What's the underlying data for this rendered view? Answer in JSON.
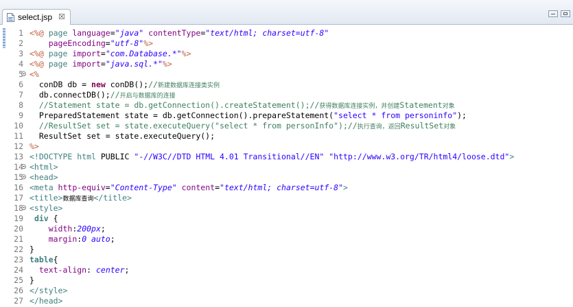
{
  "tab": {
    "label": "select.jsp",
    "icon": "jsp-file-icon",
    "close_glyph": "☒"
  },
  "colors": {
    "keyword": "#7f0055",
    "directive": "#bf5f3f",
    "tag": "#3f7f7f",
    "attribute": "#7f007f",
    "value": "#2a00ff",
    "comment": "#3f7f5f"
  },
  "lines": [
    {
      "n": "1",
      "fold": false,
      "tokens": [
        {
          "t": "dir",
          "v": "<%@ "
        },
        {
          "t": "tag",
          "v": "page "
        },
        {
          "t": "attr",
          "v": "language"
        },
        {
          "t": "plain",
          "v": "="
        },
        {
          "t": "val",
          "v": "\"java\""
        },
        {
          "t": "plain",
          "v": " "
        },
        {
          "t": "attr",
          "v": "contentType"
        },
        {
          "t": "plain",
          "v": "="
        },
        {
          "t": "val",
          "v": "\"text/html; charset=utf-8\""
        }
      ]
    },
    {
      "n": "2",
      "fold": false,
      "tokens": [
        {
          "t": "plain",
          "v": "    "
        },
        {
          "t": "attr",
          "v": "pageEncoding"
        },
        {
          "t": "plain",
          "v": "="
        },
        {
          "t": "val",
          "v": "\"utf-8\""
        },
        {
          "t": "dir",
          "v": "%>"
        }
      ]
    },
    {
      "n": "3",
      "fold": false,
      "tokens": [
        {
          "t": "dir",
          "v": "<%@ "
        },
        {
          "t": "tag",
          "v": "page "
        },
        {
          "t": "attr",
          "v": "import"
        },
        {
          "t": "plain",
          "v": "="
        },
        {
          "t": "val",
          "v": "\"com.Database.*\""
        },
        {
          "t": "dir",
          "v": "%>"
        }
      ]
    },
    {
      "n": "4",
      "fold": false,
      "tokens": [
        {
          "t": "dir",
          "v": "<%@ "
        },
        {
          "t": "tag",
          "v": "page "
        },
        {
          "t": "attr",
          "v": "import"
        },
        {
          "t": "plain",
          "v": "="
        },
        {
          "t": "val",
          "v": "\"java.sql.*\""
        },
        {
          "t": "dir",
          "v": "%>"
        }
      ]
    },
    {
      "n": "5",
      "fold": true,
      "tokens": [
        {
          "t": "dir",
          "v": "<%"
        }
      ]
    },
    {
      "n": "6",
      "fold": false,
      "tokens": [
        {
          "t": "plain",
          "v": "  conDB db = "
        },
        {
          "t": "kw",
          "v": "new"
        },
        {
          "t": "plain",
          "v": " conDB();"
        },
        {
          "t": "com",
          "v": "//"
        },
        {
          "t": "cmtsmall",
          "v": "新建数据库连接类实例"
        }
      ]
    },
    {
      "n": "7",
      "fold": false,
      "tokens": [
        {
          "t": "plain",
          "v": "  db.connectDB();"
        },
        {
          "t": "com",
          "v": "//"
        },
        {
          "t": "cmtsmall",
          "v": "开启与数据库的连接"
        }
      ]
    },
    {
      "n": "8",
      "fold": false,
      "tokens": [
        {
          "t": "com",
          "v": "  //Statement state = db.getConnection().createStatement();//"
        },
        {
          "t": "cmtsmall",
          "v": "获得数据库连接实例，并创建"
        },
        {
          "t": "com",
          "v": "Statement"
        },
        {
          "t": "cmtsmall",
          "v": "对象"
        }
      ]
    },
    {
      "n": "9",
      "fold": false,
      "tokens": [
        {
          "t": "plain",
          "v": "  PreparedStatement state = db.getConnection().prepareStatement("
        },
        {
          "t": "str",
          "v": "\"select * from personinfo\""
        },
        {
          "t": "plain",
          "v": ");"
        }
      ]
    },
    {
      "n": "10",
      "fold": false,
      "tokens": [
        {
          "t": "com",
          "v": "  //ResultSet set = state.executeQuery(\"select * from personInfo\");//"
        },
        {
          "t": "cmtsmall",
          "v": "执行查询，返回"
        },
        {
          "t": "com",
          "v": "ResultSet"
        },
        {
          "t": "cmtsmall",
          "v": "对象"
        }
      ]
    },
    {
      "n": "11",
      "fold": false,
      "tokens": [
        {
          "t": "plain",
          "v": "  ResultSet set = state.executeQuery();"
        }
      ]
    },
    {
      "n": "12",
      "fold": false,
      "tokens": [
        {
          "t": "dir",
          "v": "%>"
        }
      ]
    },
    {
      "n": "13",
      "fold": false,
      "tokens": [
        {
          "t": "tag",
          "v": "<!DOCTYPE "
        },
        {
          "t": "tag",
          "v": "html "
        },
        {
          "t": "plain",
          "v": "PUBLIC "
        },
        {
          "t": "str",
          "v": "\"-//W3C//DTD HTML 4.01 Transitional//EN\""
        },
        {
          "t": "plain",
          "v": " "
        },
        {
          "t": "str",
          "v": "\"http://www.w3.org/TR/html4/loose.dtd\""
        },
        {
          "t": "tag",
          "v": ">"
        }
      ]
    },
    {
      "n": "14",
      "fold": true,
      "tokens": [
        {
          "t": "tag",
          "v": "<html>"
        }
      ]
    },
    {
      "n": "15",
      "fold": true,
      "tokens": [
        {
          "t": "tag",
          "v": "<head>"
        }
      ]
    },
    {
      "n": "16",
      "fold": false,
      "tokens": [
        {
          "t": "tag",
          "v": "<meta "
        },
        {
          "t": "attr",
          "v": "http-equiv"
        },
        {
          "t": "plain",
          "v": "="
        },
        {
          "t": "val",
          "v": "\"Content-Type\""
        },
        {
          "t": "plain",
          "v": " "
        },
        {
          "t": "attr",
          "v": "content"
        },
        {
          "t": "plain",
          "v": "="
        },
        {
          "t": "val",
          "v": "\"text/html; charset=utf-8\""
        },
        {
          "t": "tag",
          "v": ">"
        }
      ]
    },
    {
      "n": "17",
      "fold": false,
      "tokens": [
        {
          "t": "tag",
          "v": "<title>"
        },
        {
          "t": "small",
          "v": "数据库查询"
        },
        {
          "t": "tag",
          "v": "</title>"
        }
      ]
    },
    {
      "n": "18",
      "fold": true,
      "tokens": [
        {
          "t": "tag",
          "v": "<style>"
        }
      ]
    },
    {
      "n": "19",
      "fold": false,
      "tokens": [
        {
          "t": "plain",
          "v": " "
        },
        {
          "t": "csssel",
          "v": "div"
        },
        {
          "t": "plain",
          "v": " {"
        }
      ]
    },
    {
      "n": "20",
      "fold": false,
      "tokens": [
        {
          "t": "plain",
          "v": "    "
        },
        {
          "t": "cssprop",
          "v": "width"
        },
        {
          "t": "plain",
          "v": ":"
        },
        {
          "t": "cssval",
          "v": "200px"
        },
        {
          "t": "plain",
          "v": ";"
        }
      ]
    },
    {
      "n": "21",
      "fold": false,
      "tokens": [
        {
          "t": "plain",
          "v": "    "
        },
        {
          "t": "cssprop",
          "v": "margin"
        },
        {
          "t": "plain",
          "v": ":"
        },
        {
          "t": "cssval",
          "v": "0 auto"
        },
        {
          "t": "plain",
          "v": ";"
        }
      ]
    },
    {
      "n": "22",
      "fold": false,
      "tokens": [
        {
          "t": "plain",
          "v": "}"
        }
      ]
    },
    {
      "n": "23",
      "fold": false,
      "tokens": [
        {
          "t": "csssel",
          "v": "table"
        },
        {
          "t": "plain",
          "v": "{"
        }
      ]
    },
    {
      "n": "24",
      "fold": false,
      "tokens": [
        {
          "t": "plain",
          "v": "  "
        },
        {
          "t": "cssprop",
          "v": "text-align"
        },
        {
          "t": "plain",
          "v": ": "
        },
        {
          "t": "cssval",
          "v": "center"
        },
        {
          "t": "plain",
          "v": ";"
        }
      ]
    },
    {
      "n": "25",
      "fold": false,
      "tokens": [
        {
          "t": "plain",
          "v": "}"
        }
      ]
    },
    {
      "n": "26",
      "fold": false,
      "tokens": [
        {
          "t": "tag",
          "v": "</style>"
        }
      ]
    },
    {
      "n": "27",
      "fold": false,
      "tokens": [
        {
          "t": "tag",
          "v": "</head>"
        }
      ]
    }
  ]
}
